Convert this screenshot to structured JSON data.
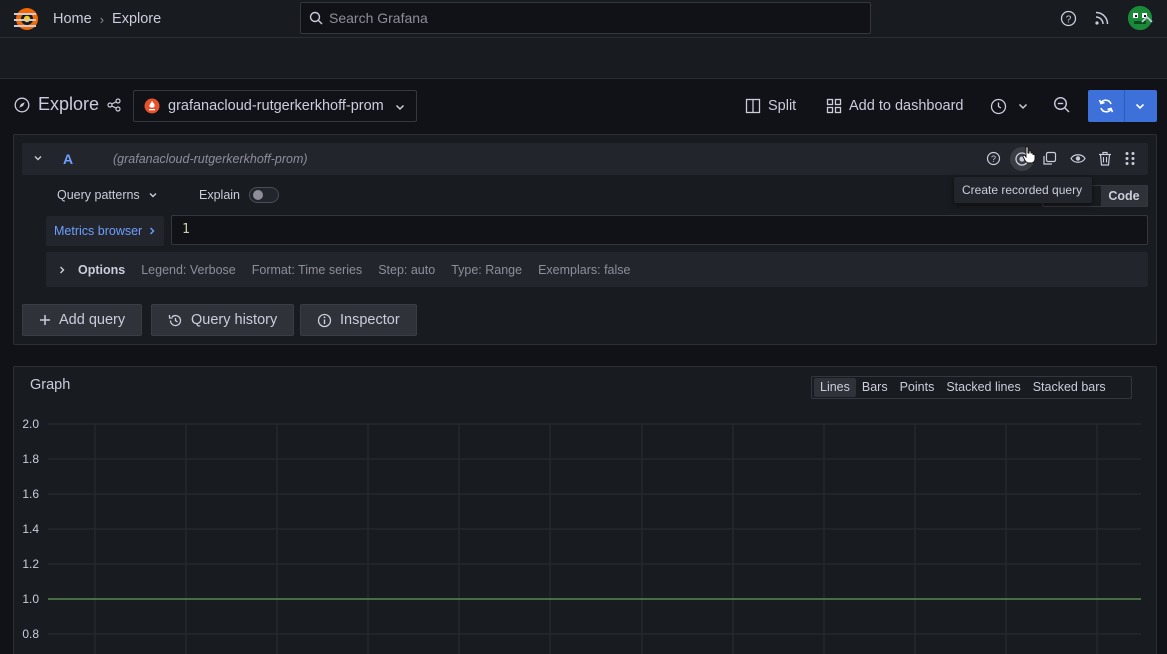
{
  "topbar": {
    "search_placeholder": "Search Grafana"
  },
  "breadcrumb": {
    "items": [
      "Home",
      "Explore"
    ],
    "separator": "›"
  },
  "explore": {
    "title": "Explore",
    "datasource": "grafanacloud-rutgerkerkhoff-prom",
    "split_label": "Split",
    "add_to_dashboard_label": "Add to dashboard"
  },
  "query": {
    "letter": "A",
    "datasource_hint": "(grafanacloud-rutgerkerkhoff-prom)",
    "query_patterns_label": "Query patterns",
    "explain_label": "Explain",
    "explain_enabled": false,
    "tooltip": "Create recorded query",
    "mode_code_label": "Code",
    "metrics_browser_label": "Metrics browser",
    "expression": "1",
    "options": {
      "label": "Options",
      "legend": "Legend: Verbose",
      "format": "Format: Time series",
      "step": "Step: auto",
      "type": "Type: Range",
      "exemplars": "Exemplars: false"
    }
  },
  "actions": {
    "add_query": "Add query",
    "query_history": "Query history",
    "inspector": "Inspector"
  },
  "graph": {
    "title": "Graph",
    "viz_options": [
      "Lines",
      "Bars",
      "Points",
      "Stacked lines",
      "Stacked bars"
    ],
    "active_viz": "Lines"
  },
  "chart_data": {
    "type": "line",
    "y_ticks": [
      "2.0",
      "1.8",
      "1.6",
      "1.4",
      "1.2",
      "1.0",
      "0.8"
    ],
    "series": [
      {
        "values": [
          1,
          1
        ]
      }
    ],
    "line_color": "#73bf69"
  },
  "colors": {
    "accent": "#3d71d9",
    "link": "#6e9fff",
    "background": "#111217",
    "panel": "#181b1f"
  }
}
